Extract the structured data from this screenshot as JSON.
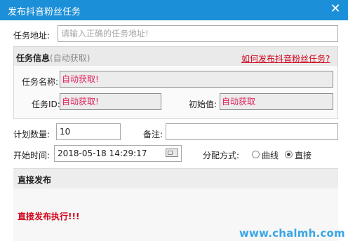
{
  "window": {
    "title": "发布抖音粉丝任务",
    "close_glyph": "✕"
  },
  "form": {
    "task_url": {
      "label": "任务地址:",
      "placeholder": "请输入正确的任务地址!"
    },
    "task_info": {
      "title": "任务信息",
      "subtitle": "(自动获取)",
      "help_link": "如何发布抖音粉丝任务?",
      "name_label": "任务名称:",
      "name_value": "自动获取!",
      "id_label": "任务ID:",
      "id_value": "自动获取!",
      "initial_label": "初始值:",
      "initial_value": "自动获取"
    },
    "plan_qty": {
      "label": "计划数量:",
      "value": "10"
    },
    "remark": {
      "label": "备注:",
      "value": ""
    },
    "start_time": {
      "label": "开始时间:",
      "value": "2018-05-18 14:29:17"
    },
    "distribution": {
      "label": "分配方式:",
      "options": [
        {
          "label": "曲线",
          "selected": false
        },
        {
          "label": "直接",
          "selected": true
        }
      ]
    }
  },
  "direct_panel": {
    "title": "直接发布",
    "message": "直接发布执行!!!"
  },
  "watermark": "www.chalmh.com"
}
